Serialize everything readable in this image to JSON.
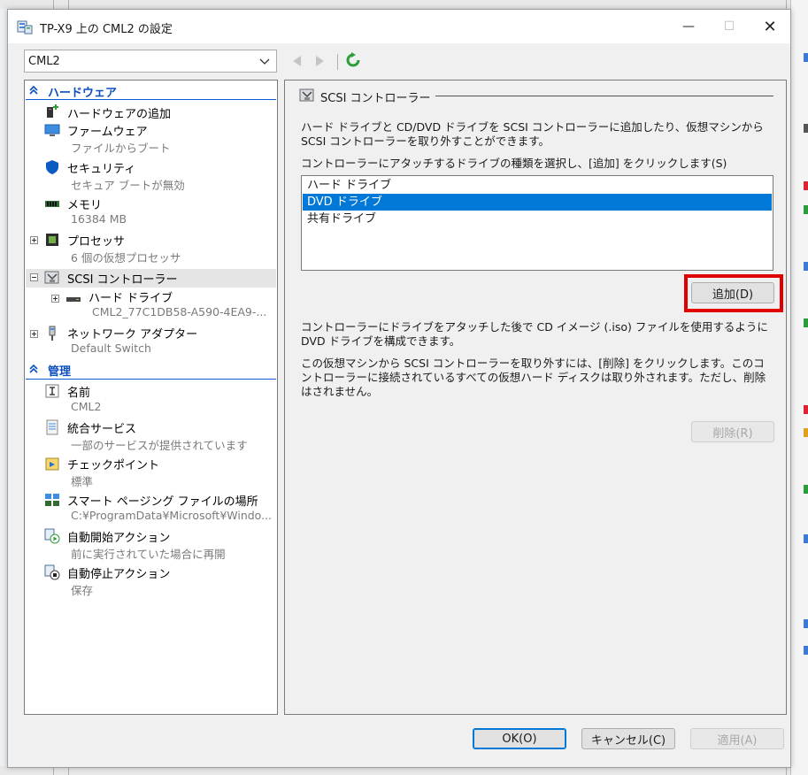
{
  "window": {
    "title": "TP-X9 上の CML2 の設定",
    "minimize_symbol": "—",
    "maximize_symbol": "☐",
    "close_symbol": "✕"
  },
  "vm_selector": {
    "value": "CML2"
  },
  "nav": {
    "back_icon": "back-arrow-icon",
    "forward_icon": "forward-arrow-icon",
    "refresh_icon": "refresh-icon"
  },
  "tree": {
    "hardware_header": "ハードウェア",
    "items": [
      {
        "label": "ハードウェアの追加",
        "sub": ""
      },
      {
        "label": "ファームウェア",
        "sub": "ファイルからブート"
      },
      {
        "label": "セキュリティ",
        "sub": "セキュア ブートが無効"
      },
      {
        "label": "メモリ",
        "sub": "16384 MB"
      },
      {
        "label": "プロセッサ",
        "sub": "6 個の仮想プロセッサ"
      },
      {
        "label": "SCSI コントローラー",
        "sub": ""
      },
      {
        "label": "ハード ドライブ",
        "sub": "CML2_77C1DB58-A590-4EA9-..."
      },
      {
        "label": "ネットワーク アダプター",
        "sub": "Default Switch"
      }
    ],
    "management_header": "管理",
    "mgmt_items": [
      {
        "label": "名前",
        "sub": "CML2"
      },
      {
        "label": "統合サービス",
        "sub": "一部のサービスが提供されています"
      },
      {
        "label": "チェックポイント",
        "sub": "標準"
      },
      {
        "label": "スマート ページング ファイルの場所",
        "sub": "C:¥ProgramData¥Microsoft¥Windo..."
      },
      {
        "label": "自動開始アクション",
        "sub": "前に実行されていた場合に再開"
      },
      {
        "label": "自動停止アクション",
        "sub": "保存"
      }
    ]
  },
  "panel": {
    "title": "SCSI コントローラー",
    "desc1": "ハード ドライブと CD/DVD ドライブを SCSI コントローラーに追加したり、仮想マシンから SCSI コントローラーを取り外すことができます。",
    "select_prompt": "コントローラーにアタッチするドライブの種類を選択し、[追加] をクリックします(S)",
    "drive_types": [
      "ハード ドライブ",
      "DVD ドライブ",
      "共有ドライブ"
    ],
    "selected_index": 1,
    "add_button": "追加(D)",
    "desc2": "コントローラーにドライブをアタッチした後で CD イメージ (.iso) ファイルを使用するように DVD ドライブを構成できます。",
    "desc3": "この仮想マシンから SCSI コントローラーを取り外すには、[削除] をクリックします。このコントローラーに接続されているすべての仮想ハード ディスクは取り外されます。ただし、削除はされません。",
    "remove_button": "削除(R)"
  },
  "footer": {
    "ok": "OK(O)",
    "cancel": "キャンセル(C)",
    "apply": "適用(A)"
  },
  "colors": {
    "accent": "#0078d7",
    "header": "#0a4fbf",
    "highlight": "#e10000"
  }
}
